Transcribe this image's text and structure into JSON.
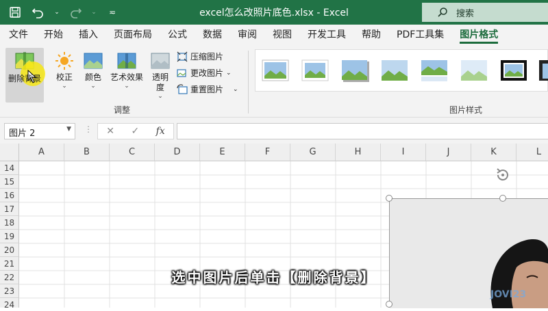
{
  "titlebar": {
    "title": "excel怎么改照片底色.xlsx  -  Excel",
    "search_label": "搜索"
  },
  "tabs": [
    "文件",
    "开始",
    "插入",
    "页面布局",
    "公式",
    "数据",
    "审阅",
    "视图",
    "开发工具",
    "帮助",
    "PDF工具集",
    "图片格式"
  ],
  "active_tab": "图片格式",
  "ribbon": {
    "remove_background": "删除背景",
    "corrections": "校正",
    "color": "颜色",
    "artistic_effects": "艺术效果",
    "transparency": "透明度",
    "compress": "压缩图片",
    "change_picture": "更改图片",
    "reset_picture": "重置图片",
    "adjust_group": "调整",
    "styles_group": "图片样式"
  },
  "formula_bar": {
    "name_box": "图片 2",
    "cancel": "✕",
    "enter": "✓",
    "fx": "fx",
    "value": ""
  },
  "columns": [
    "A",
    "B",
    "C",
    "D",
    "E",
    "F",
    "G",
    "H",
    "I",
    "J",
    "K",
    "L"
  ],
  "rows": [
    "14",
    "15",
    "16",
    "17",
    "18",
    "19",
    "20",
    "21",
    "22",
    "23",
    "24"
  ],
  "caption": "选中图片后单击【删除背景】",
  "watermark": "JOVI23",
  "colors": {
    "excel_green": "#217346",
    "accent_tab": "#1b6b3c"
  }
}
